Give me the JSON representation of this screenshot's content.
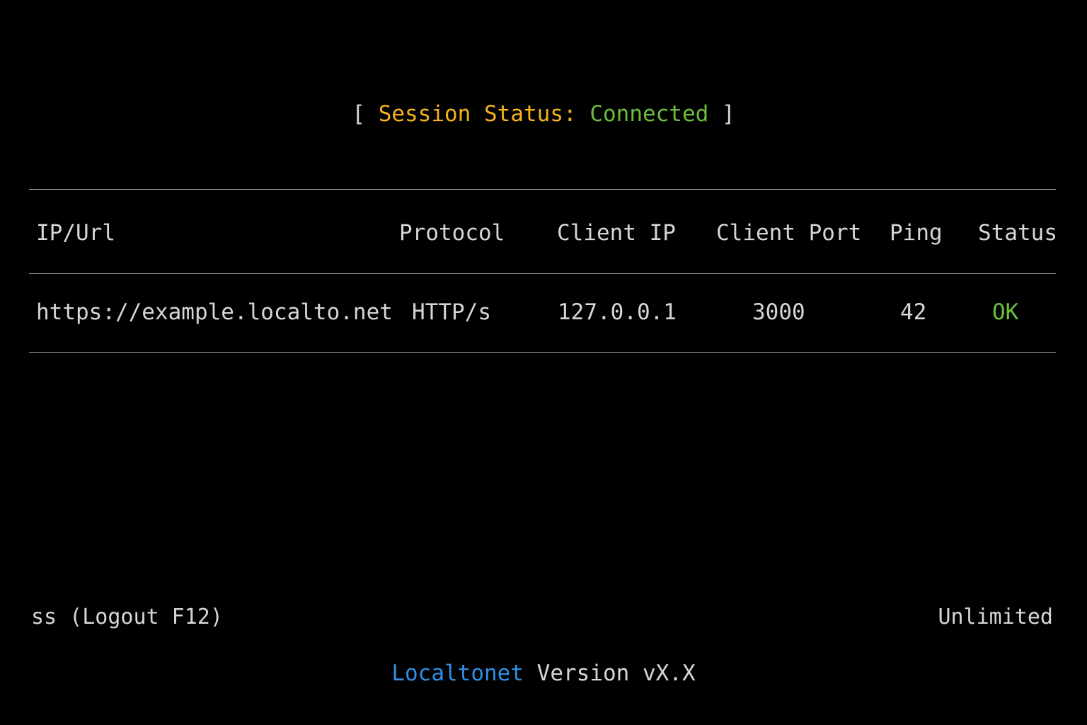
{
  "colors": {
    "label_yellow": "#f5b21b",
    "status_green": "#6cbf3c",
    "brand_blue": "#2f8fe3",
    "text": "#d6d6d6",
    "rule": "#9a9a9a",
    "background": "#000000"
  },
  "session": {
    "open_bracket": "[",
    "label": "Session Status:",
    "value": "Connected",
    "close_bracket": "]"
  },
  "table": {
    "headers": {
      "ip_url": "IP/Url",
      "protocol": "Protocol",
      "client_ip": "Client IP",
      "client_port": "Client Port",
      "ping": "Ping",
      "status": "Status"
    },
    "rows": [
      {
        "ip_url": "https://example.localto.net",
        "protocol": "HTTP/s",
        "client_ip": "127.0.0.1",
        "client_port": "3000",
        "ping": "42",
        "status": "OK"
      }
    ]
  },
  "footer": {
    "left": "ss (Logout F12)",
    "right": "Unlimited"
  },
  "version": {
    "brand": "Localtonet",
    "text": "Version vX.X"
  }
}
